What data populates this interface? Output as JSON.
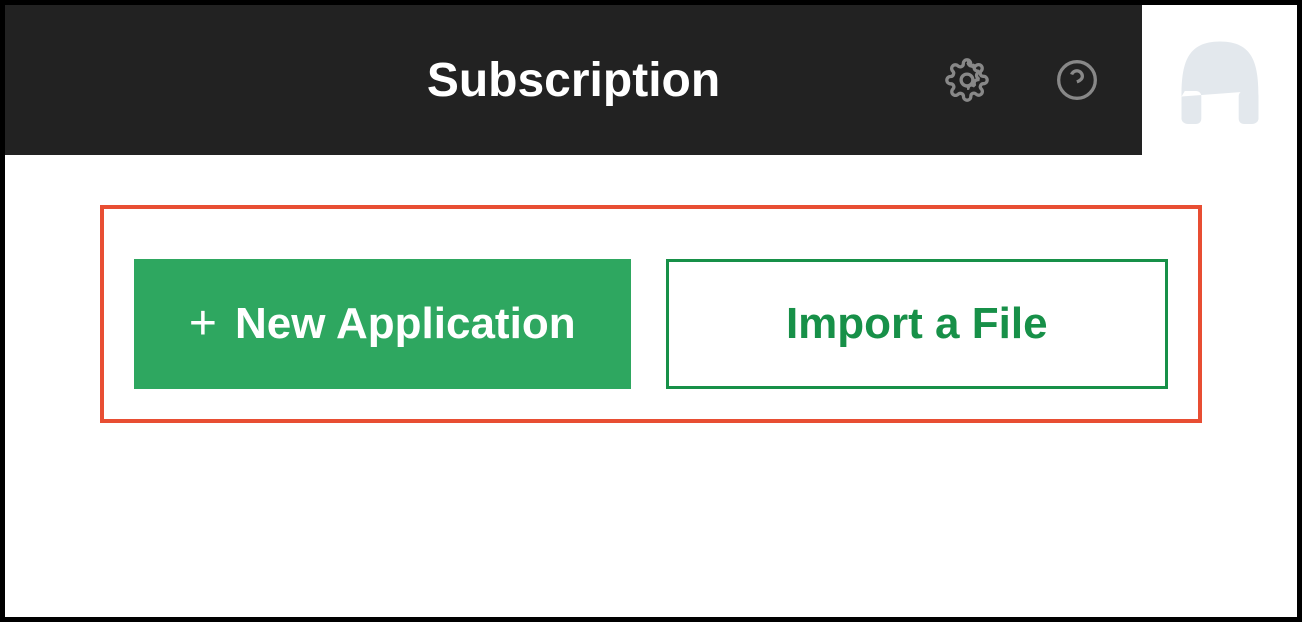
{
  "header": {
    "title": "Subscription"
  },
  "icons": {
    "gear": "gear-icon",
    "help": "help-icon",
    "profile": "headset-icon"
  },
  "buttons": {
    "new_application": {
      "label": "New Application",
      "plus": "+"
    },
    "import_file": {
      "label": "Import a File"
    }
  }
}
